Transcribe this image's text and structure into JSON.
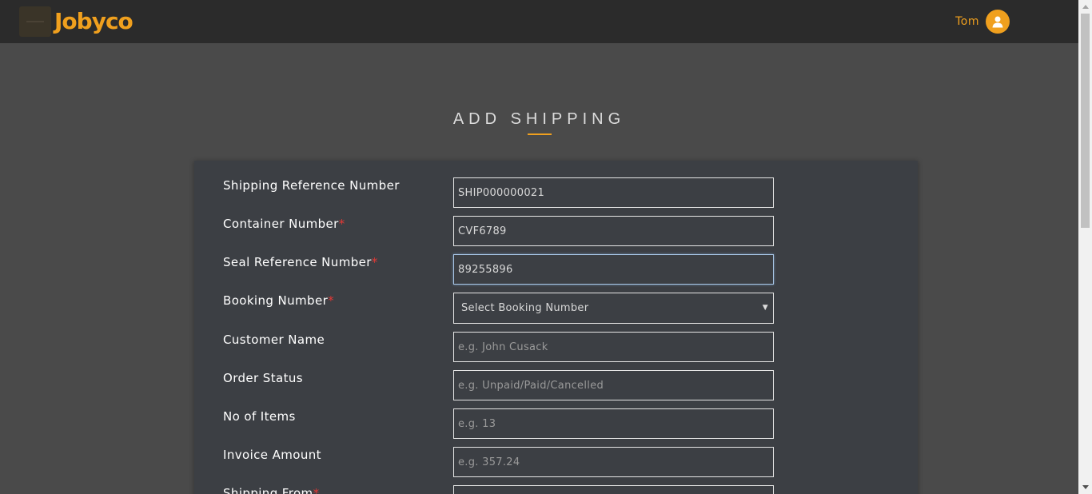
{
  "app": {
    "logo_text": "Jobyco",
    "user_name": "Tom",
    "accent_color": "#f0a01e"
  },
  "page": {
    "title": "ADD SHIPPING"
  },
  "form": {
    "shipping_ref": {
      "label": "Shipping Reference Number",
      "value": "SHIP000000021",
      "required": false
    },
    "container_number": {
      "label": "Container Number",
      "value": "CVF6789",
      "required": true
    },
    "seal_ref": {
      "label": "Seal Reference Number",
      "value": "89255896",
      "required": true
    },
    "booking_number": {
      "label": "Booking Number",
      "selected": "Select Booking Number",
      "required": true
    },
    "customer_name": {
      "label": "Customer Name",
      "placeholder": "e.g. John Cusack"
    },
    "order_status": {
      "label": "Order Status",
      "placeholder": "e.g. Unpaid/Paid/Cancelled"
    },
    "no_of_items": {
      "label": "No of Items",
      "placeholder": "e.g. 13"
    },
    "invoice_amount": {
      "label": "Invoice Amount",
      "placeholder": "e.g. 357.24"
    },
    "shipping_from": {
      "label": "Shipping From",
      "required": true
    }
  },
  "required_marker": "*",
  "icons": {
    "menu": "hamburger-icon",
    "user": "user-icon",
    "select_arrow": "triangle-down",
    "scroll_up": "triangle-up",
    "scroll_down": "triangle-down"
  }
}
